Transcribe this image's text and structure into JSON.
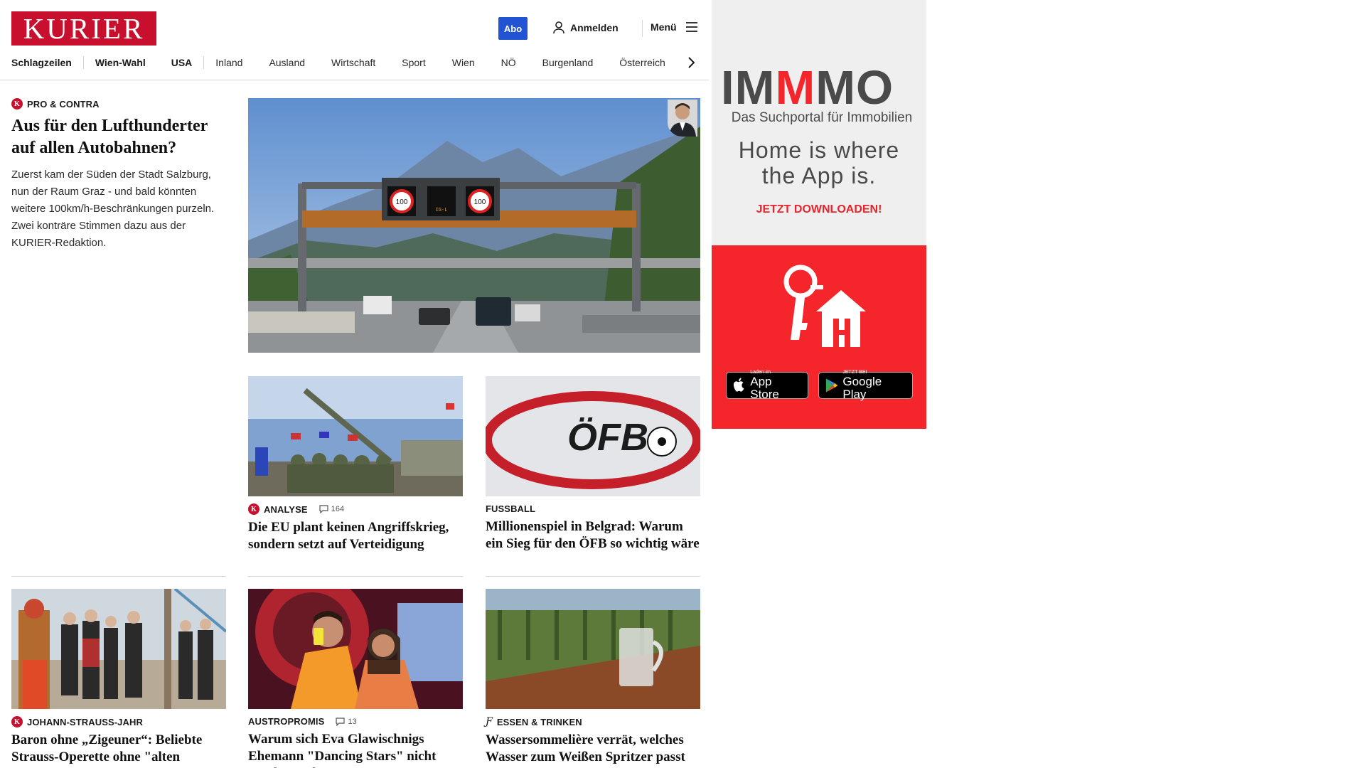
{
  "header": {
    "logo_text": "KURIER",
    "abo_label": "Abo",
    "login_label": "Anmelden",
    "menu_label": "Menü"
  },
  "nav": {
    "items": [
      "Schlagzeilen",
      "Wien-Wahl",
      "USA",
      "Inland",
      "Ausland",
      "Wirtschaft",
      "Sport",
      "Wien",
      "NÖ",
      "Burgenland",
      "Österreich"
    ]
  },
  "lead": {
    "kicker": "PRO & CONTRA",
    "title": "Aus für den Lufthunderter auf allen Autobahnen?",
    "teaser": "Zuerst kam der Süden der Stadt Salzburg, nun der Raum Graz - und bald könnten weitere 100km/h-Beschränkungen purzeln. Zwei konträre Stimmen dazu aus der KURIER-Redaktion.",
    "hero_signs": [
      "100",
      "IG-L",
      "100"
    ]
  },
  "cards": [
    {
      "kicker": "ANALYSE",
      "comments": "164",
      "title": "Die EU plant keinen Angriffskrieg, sondern setzt auf Verteidigung"
    },
    {
      "kicker": "FUSSBALL",
      "image_text": "ÖFB",
      "title": "Millionenspiel in Belgrad: Warum ein Sieg für den ÖFB so wichtig wäre"
    },
    {
      "kicker": "JOHANN-STRAUSS-JAHR",
      "title": "Baron ohne „Zigeuner“: Beliebte Strauss-Operette ohne \"alten Rassismus\" neu erzählt"
    },
    {
      "kicker": "AUSTROPROMIS",
      "comments": "13",
      "title": "Warum sich Eva Glawischnigs Ehemann \"Dancing Stars\" nicht anschauen kann"
    },
    {
      "kicker": "ESSEN & TRINKEN",
      "title": "Wassersommelière verrät, welches Wasser zum Weißen Spritzer passt"
    }
  ],
  "ad": {
    "brand_a": "IM",
    "brand_b": "M",
    "brand_c": "MO",
    "subtitle": "Das Suchportal für Immobilien",
    "slogan_1": "Home is where",
    "slogan_2": "the App is.",
    "cta": "JETZT DOWNLOADEN!",
    "appstore_small": "Laden im",
    "appstore_big": "App Store",
    "googleplay_small": "JETZT BEI",
    "googleplay_big": "Google Play"
  },
  "colors": {
    "brand_red": "#c8102e",
    "abo_blue": "#2253d5",
    "ad_red": "#f5262b"
  }
}
